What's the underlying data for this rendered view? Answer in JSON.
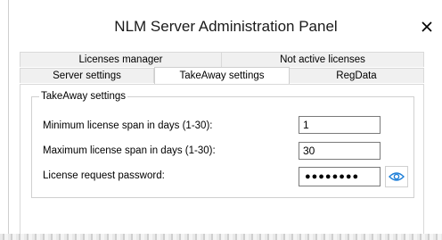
{
  "window": {
    "title": "NLM Server Administration Panel",
    "close_glyph": "✕"
  },
  "tabs": {
    "back_row": [
      {
        "label": "Licenses manager"
      },
      {
        "label": "Not active licenses"
      }
    ],
    "front_row": [
      {
        "label": "Server settings",
        "active": false
      },
      {
        "label": "TakeAway settings",
        "active": true
      },
      {
        "label": "RegData",
        "active": false
      }
    ]
  },
  "takeaway": {
    "group_title": "TakeAway settings",
    "min_span": {
      "label": "Minimum license span in days (1-30):",
      "value": "1"
    },
    "max_span": {
      "label": "Maximum license span in days (1-30):",
      "value": "30"
    },
    "password": {
      "label": "License request password:",
      "masked_value": "●●●●●●●●",
      "reveal_icon": "eye-icon"
    }
  },
  "colors": {
    "accent": "#1e7fd8",
    "tab_inactive_bg": "#f0f0f0",
    "border": "#d9d9d9"
  }
}
